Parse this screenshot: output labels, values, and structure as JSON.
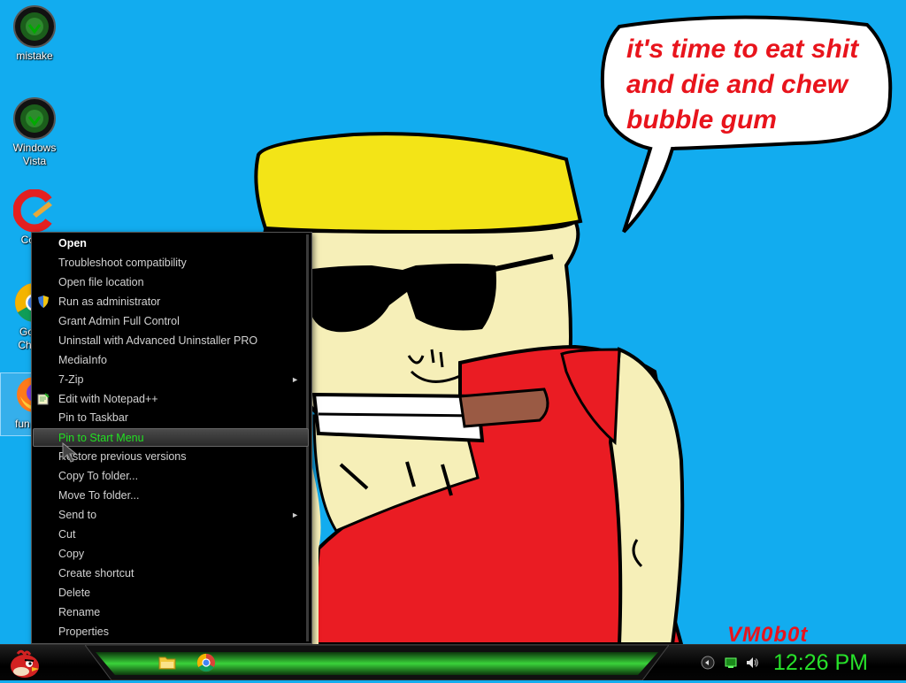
{
  "desktop": {
    "icons": [
      {
        "label": "mistake",
        "icon": "green-orb-icon"
      },
      {
        "label": "Windows Vista",
        "icon": "green-orb-icon"
      },
      {
        "label": "Cockt",
        "icon": "ccleaner-icon"
      },
      {
        "label": "Go Chr",
        "icon": "chrome-icon"
      },
      {
        "label": "fun",
        "icon": "firefox-icon",
        "selected": true
      }
    ]
  },
  "wallpaper": {
    "speech_lines": [
      "it's time to eat shit",
      "and die and chew",
      "bubble gum"
    ],
    "signature": "VM0b0t"
  },
  "context_menu": {
    "items": [
      {
        "label": "Open",
        "bold": true
      },
      {
        "label": "Troubleshoot compatibility"
      },
      {
        "label": "Open file location"
      },
      {
        "label": "Run as administrator",
        "icon": "uac-shield-icon"
      },
      {
        "label": "Grant Admin Full Control"
      },
      {
        "label": "Uninstall with Advanced Uninstaller PRO"
      },
      {
        "label": "MediaInfo"
      },
      {
        "label": "7-Zip",
        "submenu": true
      },
      {
        "label": "Edit with Notepad++",
        "icon": "notepad-plus-plus-icon"
      },
      {
        "label": "Pin to Taskbar"
      },
      {
        "label": "Pin to Start Menu",
        "highlighted": true
      },
      {
        "label": "Restore previous versions"
      },
      {
        "label": "Copy To folder..."
      },
      {
        "label": "Move To folder..."
      },
      {
        "label": "Send to",
        "submenu": true
      },
      {
        "label": "Cut"
      },
      {
        "label": "Copy"
      },
      {
        "label": "Create shortcut"
      },
      {
        "label": "Delete"
      },
      {
        "label": "Rename"
      },
      {
        "label": "Properties"
      }
    ]
  },
  "taskbar": {
    "start_icon": "angry-bird-icon",
    "pinned": [
      "folder-icon",
      "chrome-icon"
    ],
    "tray_icons": [
      "show-desktop-icon",
      "network-icon",
      "volume-icon"
    ],
    "clock": "12:26 PM"
  },
  "colors": {
    "desktop_bg": "#12acef",
    "menu_bg": "#000000",
    "menu_highlight_text": "#22e022",
    "clock": "#27e12a",
    "speech_text": "#e8141c"
  }
}
